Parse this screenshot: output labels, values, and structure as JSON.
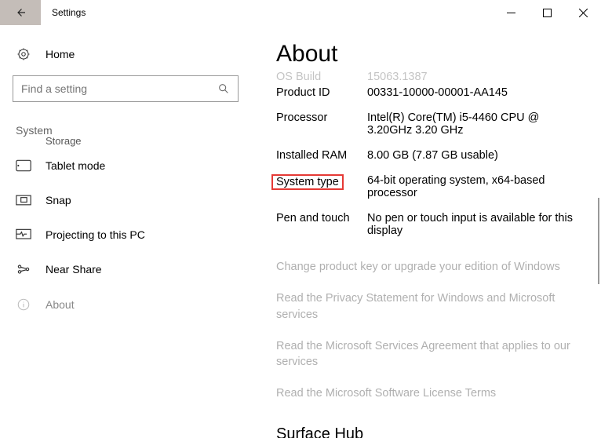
{
  "titlebar": {
    "app_name": "Settings"
  },
  "sidebar": {
    "home_label": "Home",
    "search_placeholder": "Find a setting",
    "category": "System",
    "truncated_item": "Storage",
    "items": [
      {
        "label": "Tablet mode"
      },
      {
        "label": "Snap"
      },
      {
        "label": "Projecting to this PC"
      },
      {
        "label": "Near Share"
      },
      {
        "label": "About"
      }
    ]
  },
  "main": {
    "title": "About",
    "os_build_partial": {
      "label": "OS Build",
      "value": "15063.1387"
    },
    "specs": [
      {
        "label": "Product ID",
        "value": "00331-10000-00001-AA145"
      },
      {
        "label": "Processor",
        "value": "Intel(R) Core(TM) i5-4460  CPU @ 3.20GHz   3.20 GHz"
      },
      {
        "label": "Installed RAM",
        "value": "8.00 GB (7.87 GB usable)"
      },
      {
        "label": "System type",
        "value": "64-bit operating system, x64-based processor",
        "highlight": true
      },
      {
        "label": "Pen and touch",
        "value": "No pen or touch input is available for this display"
      }
    ],
    "links": [
      "Change product key or upgrade your edition of Windows",
      "Read the Privacy Statement for Windows and Microsoft services",
      "Read the Microsoft Services Agreement that applies to our services",
      "Read the Microsoft Software License Terms"
    ],
    "next_section": "Surface Hub"
  }
}
